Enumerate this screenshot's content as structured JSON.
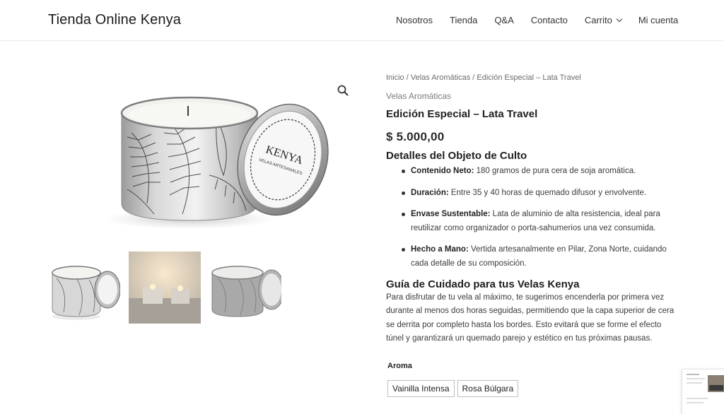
{
  "site": {
    "title": "Tienda Online Kenya"
  },
  "nav": {
    "items": [
      {
        "label": "Nosotros"
      },
      {
        "label": "Tienda"
      },
      {
        "label": "Q&A"
      },
      {
        "label": "Contacto"
      },
      {
        "label": "Carrito"
      },
      {
        "label": "Mi cuenta"
      }
    ]
  },
  "breadcrumb": {
    "home": "Inicio",
    "sep": " / ",
    "category": "Velas Aromáticas",
    "current": "Edición Especial – Lata Travel"
  },
  "product": {
    "category": "Velas Aromáticas",
    "title": "Edición Especial – Lata Travel",
    "price": "$ 5.000,00",
    "lid_brand": "KENYA",
    "lid_sub": "VELAS ARTESANALES"
  },
  "details": {
    "heading": "Detalles del Objeto de Culto",
    "items": [
      {
        "label": "Contenido Neto:",
        "text": " 180 gramos de pura cera de soja aromática."
      },
      {
        "label": "Duración:",
        "text": " Entre 35 y 40 horas de quemado difusor y envolvente."
      },
      {
        "label": "Envase Sustentable:",
        "text": " Lata de aluminio de alta resistencia, ideal para reutilizar como organizador o porta-sahumerios una vez consumida."
      },
      {
        "label": "Hecho a Mano:",
        "text": " Vertida artesanalmente en Pilar, Zona Norte, cuidando cada detalle de su composición."
      }
    ]
  },
  "guide": {
    "heading": "Guía de Cuidado para tus Velas Kenya",
    "text": "Para disfrutar de tu vela al máximo, te sugerimos encenderla por primera vez durante al menos dos horas seguidas, permitiendo que la capa superior de cera se derrita por completo hasta los bordes. Esto evitará que se forme el efecto túnel y garantizará un quemado parejo y estético en tus próximas pausas."
  },
  "aroma": {
    "label": "Aroma",
    "options": [
      {
        "label": "Vainilla Intensa"
      },
      {
        "label": "Rosa Búlgara"
      }
    ]
  },
  "icons": {
    "zoom": "search-icon",
    "cart_chevron": "chevron-down-icon"
  },
  "colors": {
    "text": "#3a3a3a",
    "heading": "#1f1f1f",
    "border": "#ececec"
  }
}
